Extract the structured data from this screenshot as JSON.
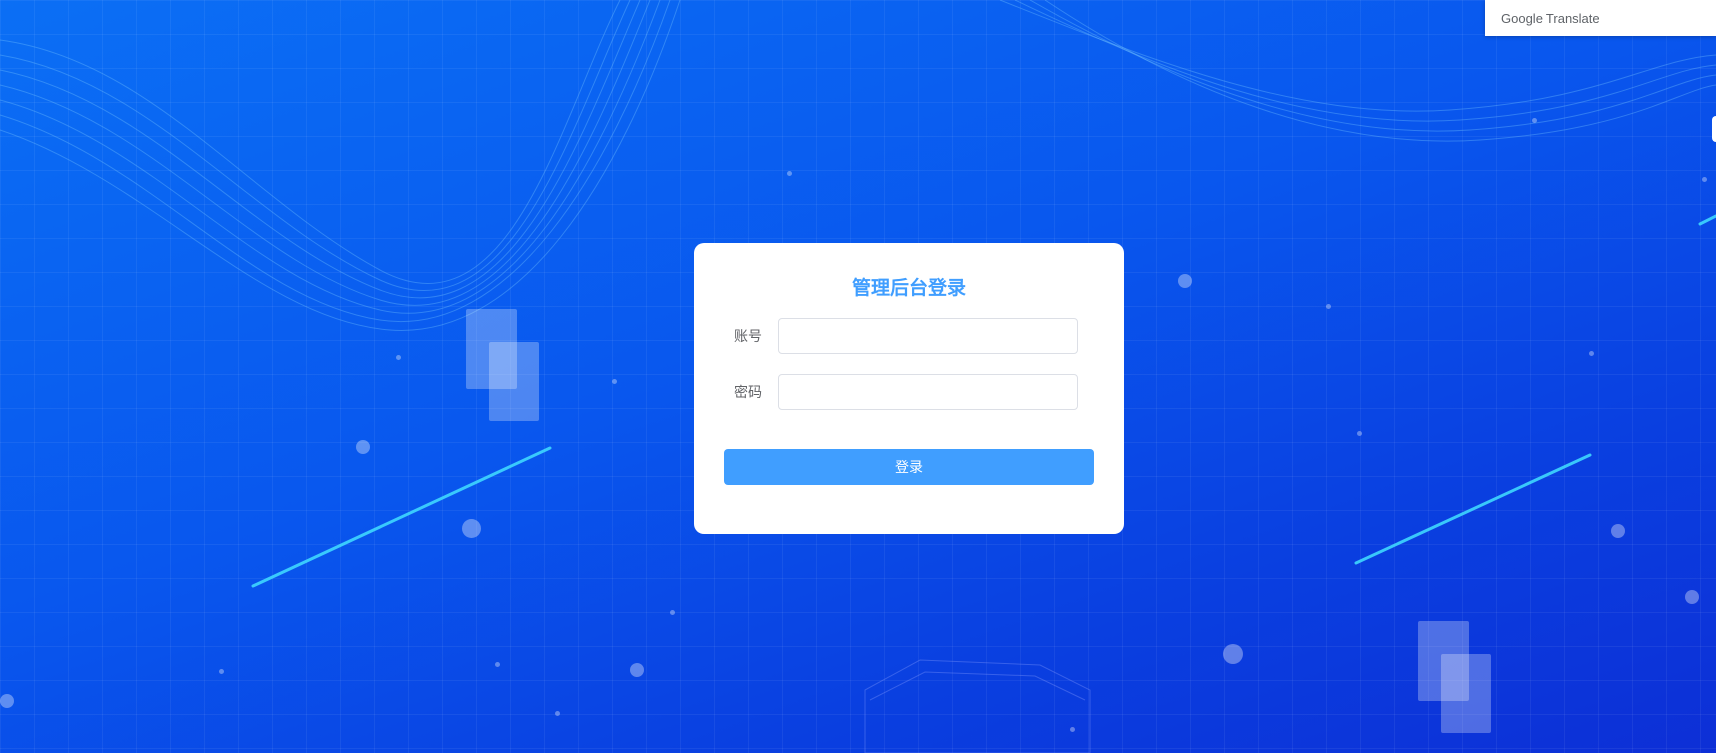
{
  "translate_widget": {
    "brand": "Google",
    "label": "Translate"
  },
  "login": {
    "title": "管理后台登录",
    "account_label": "账号",
    "account_value": "",
    "password_label": "密码",
    "password_value": "",
    "submit_label": "登录"
  },
  "colors": {
    "accent": "#409eff",
    "background_start": "#0b6ff5",
    "background_end": "#0d2fd6"
  }
}
